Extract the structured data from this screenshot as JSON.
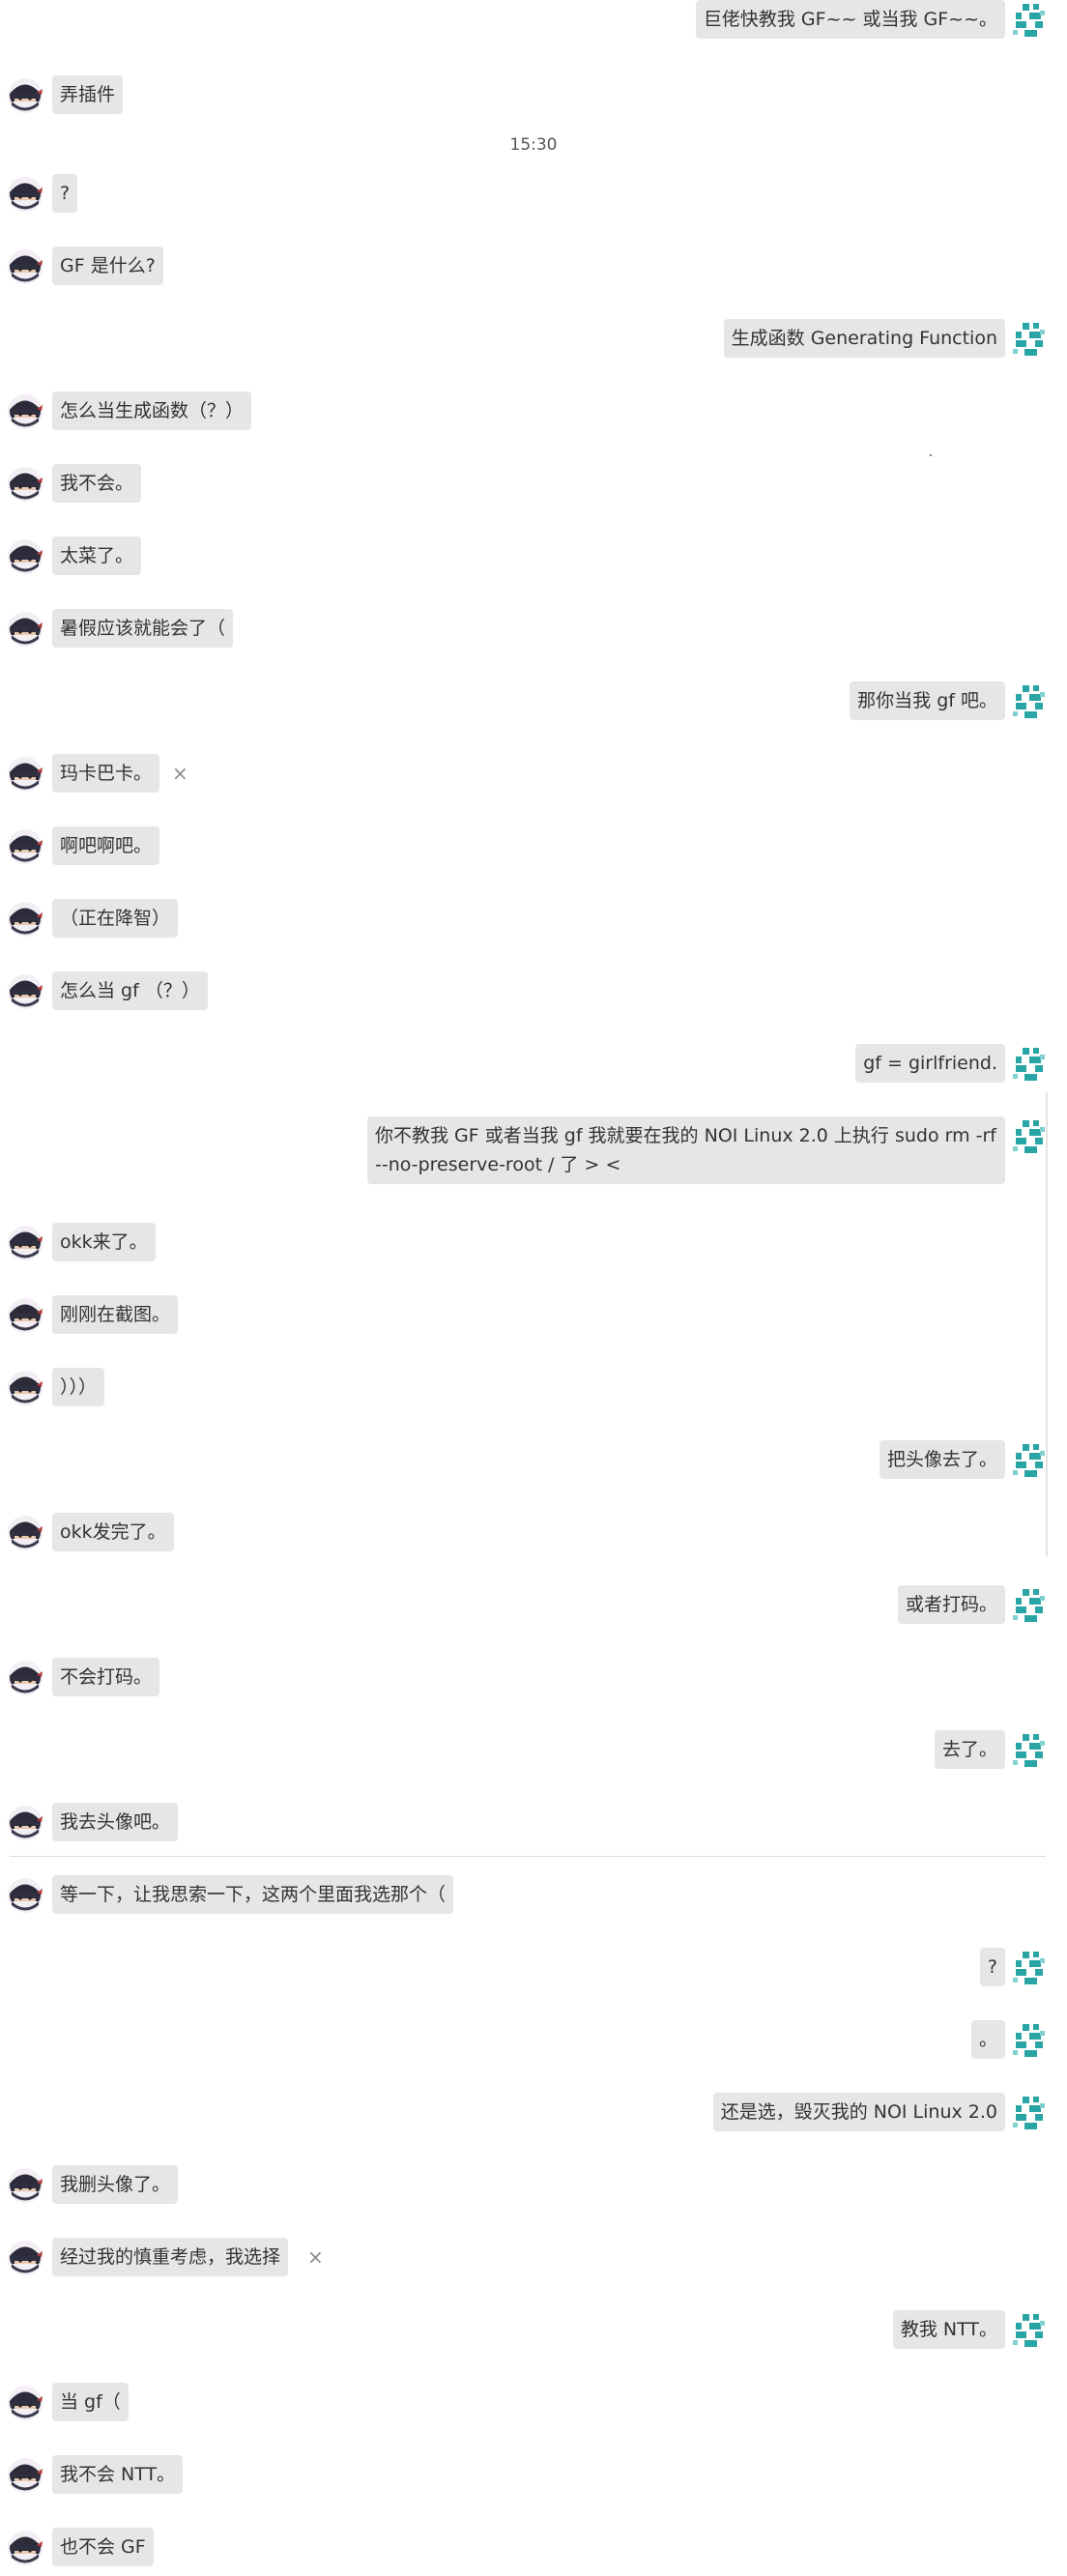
{
  "theme": {
    "bubble_bg": "#e6e6e6",
    "accent": "#2aa5a5",
    "text": "#333333"
  },
  "icons": {
    "other_avatar": "ninja-avatar-icon",
    "self_avatar": "teal-pixel-avatar-icon",
    "close": "close-icon"
  },
  "timestamp": "15:30",
  "messages": [
    {
      "side": "right",
      "text": "巨佬快教我 GF~~ 或当我 GF~~。"
    },
    {
      "side": "left",
      "text": "弄插件"
    },
    {
      "side": "left",
      "text": "?"
    },
    {
      "side": "left",
      "text": "GF 是什么?"
    },
    {
      "side": "right",
      "text": "生成函数 Generating Function"
    },
    {
      "side": "left",
      "text": "怎么当生成函数（？）"
    },
    {
      "side": "left",
      "text": "我不会。"
    },
    {
      "side": "left",
      "text": "太菜了。"
    },
    {
      "side": "left",
      "text": "暑假应该就能会了（"
    },
    {
      "side": "right",
      "text": "那你当我 gf 吧。"
    },
    {
      "side": "left",
      "text": "玛卡巴卡。",
      "close": "×"
    },
    {
      "side": "left",
      "text": "啊吧啊吧。"
    },
    {
      "side": "left",
      "text": "（正在降智）"
    },
    {
      "side": "left",
      "text": "怎么当 gf （？）"
    },
    {
      "side": "right",
      "text": "gf = girlfriend."
    },
    {
      "side": "right",
      "text": "你不教我 GF 或者当我 gf 我就要在我的 NOI Linux 2.0 上执行 sudo rm -rf --no-preserve-root / 了 > <"
    },
    {
      "side": "left",
      "text": "okk来了。"
    },
    {
      "side": "left",
      "text": "刚刚在截图。"
    },
    {
      "side": "left",
      "text": "）））"
    },
    {
      "side": "right",
      "text": "把头像去了。"
    },
    {
      "side": "left",
      "text": "okk发完了。"
    },
    {
      "side": "right",
      "text": "或者打码。"
    },
    {
      "side": "left",
      "text": "不会打码。"
    },
    {
      "side": "right",
      "text": "去了。"
    },
    {
      "side": "left",
      "text": "我去头像吧。"
    },
    {
      "side": "left",
      "text": "等一下，让我思索一下，这两个里面我选那个（"
    },
    {
      "side": "right",
      "text": "?"
    },
    {
      "side": "right",
      "text": "。"
    },
    {
      "side": "right",
      "text": "还是选，毁灭我的 NOI Linux 2.0"
    },
    {
      "side": "left",
      "text": "我删头像了。"
    },
    {
      "side": "left",
      "text": "经过我的慎重考虑，我选择",
      "close": "×"
    },
    {
      "side": "right",
      "text": "教我 NTT。"
    },
    {
      "side": "left",
      "text": "当 gf（"
    },
    {
      "side": "left",
      "text": "我不会 NTT。"
    },
    {
      "side": "left",
      "text": "也不会 GF"
    }
  ]
}
